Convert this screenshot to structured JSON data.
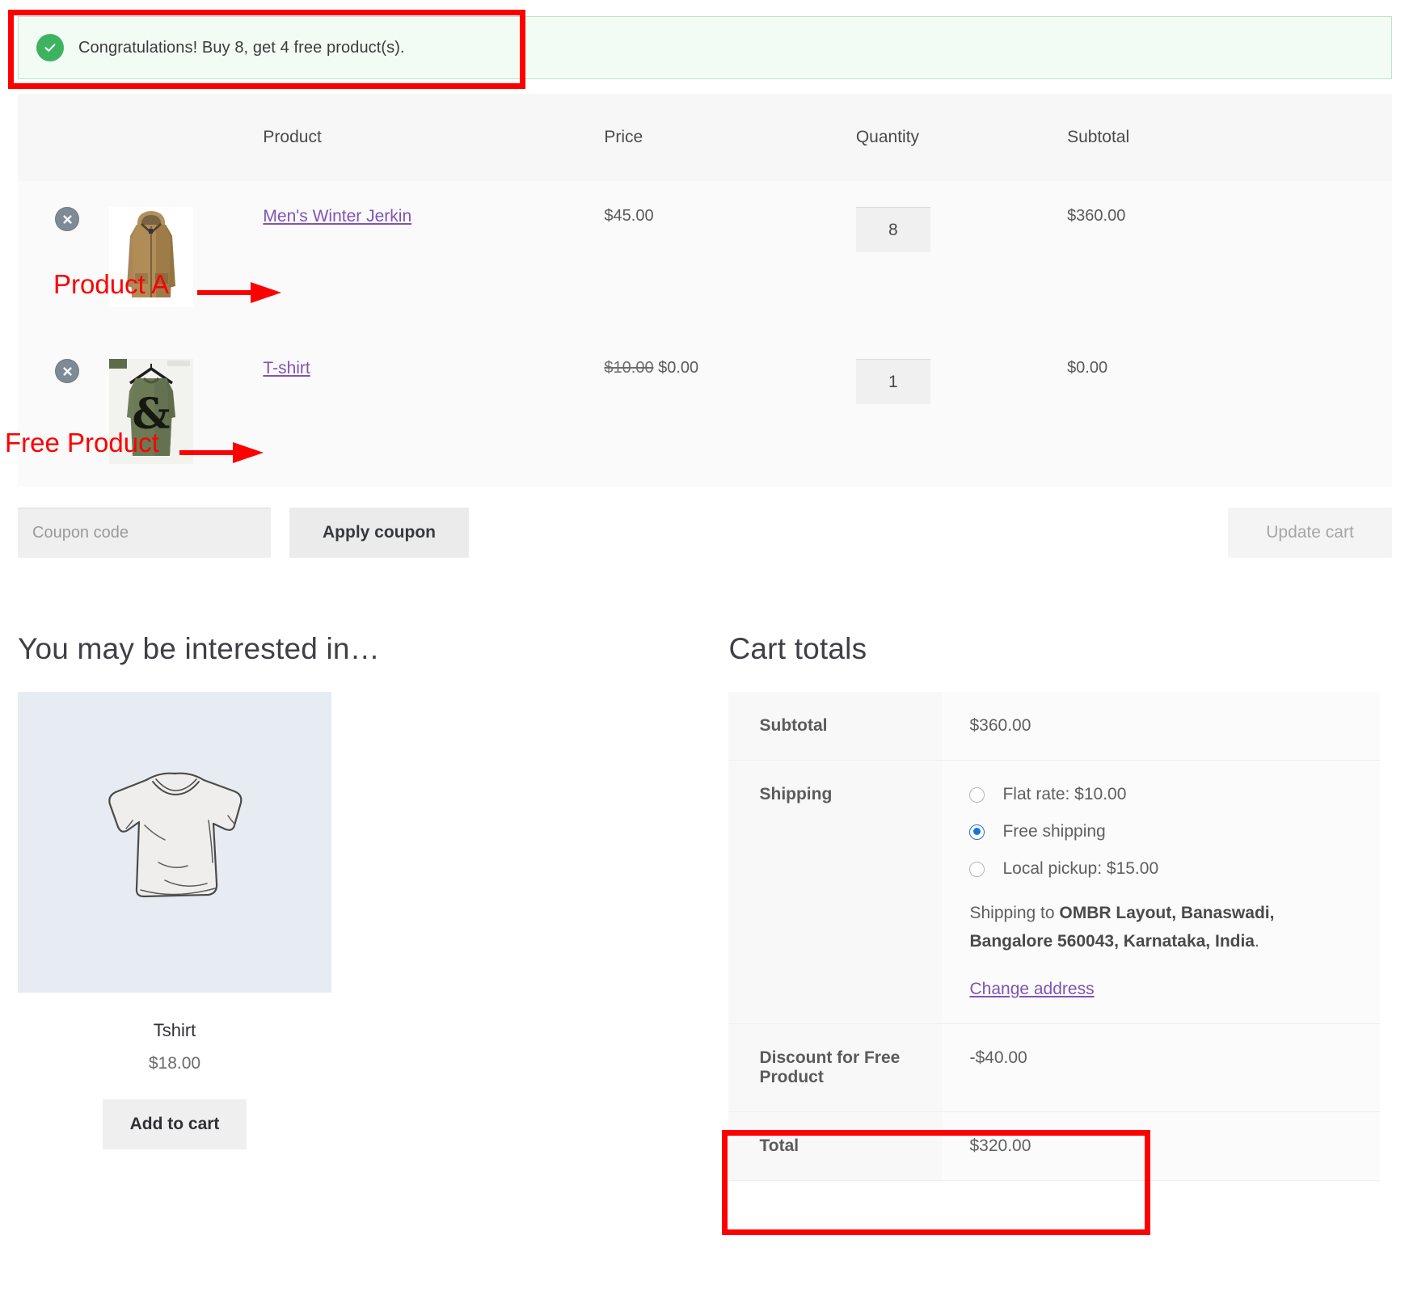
{
  "notice": {
    "icon": "check-circle-icon",
    "message": "Congratulations! Buy 8, get 4 free product(s)."
  },
  "cart_table": {
    "headers": {
      "remove": "",
      "thumbnail": "",
      "product": "Product",
      "price": "Price",
      "quantity": "Quantity",
      "subtotal": "Subtotal"
    },
    "rows": [
      {
        "remove_icon": "remove-item-icon",
        "thumbnail": "mens-winter-jerkin-thumbnail",
        "name": "Men's Winter Jerkin",
        "price": "$45.00",
        "price_original": "",
        "quantity": "8",
        "subtotal": "$360.00"
      },
      {
        "remove_icon": "remove-item-icon",
        "thumbnail": "tshirt-thumbnail",
        "name": "T-shirt",
        "price": "$0.00",
        "price_original": "$10.00",
        "quantity": "1",
        "subtotal": "$0.00"
      }
    ]
  },
  "coupon": {
    "placeholder": "Coupon code",
    "value": "",
    "apply_label": "Apply coupon",
    "update_label": "Update cart"
  },
  "upsells": {
    "heading": "You may be interested in…",
    "products": [
      {
        "image": "white-tshirt-sketch",
        "title": "Tshirt",
        "price": "$18.00",
        "button_label": "Add to cart"
      }
    ]
  },
  "cart_totals": {
    "heading": "Cart totals",
    "subtotal_label": "Subtotal",
    "subtotal_value": "$360.00",
    "shipping_label": "Shipping",
    "shipping_options": [
      {
        "label": "Flat rate: $10.00",
        "selected": false
      },
      {
        "label": "Free shipping",
        "selected": true
      },
      {
        "label": "Local pickup: $15.00",
        "selected": false
      }
    ],
    "shipping_to_prefix": "Shipping to ",
    "shipping_to_address": "OMBR Layout, Banaswadi, Bangalore 560043, Karnataka, India",
    "shipping_to_suffix": ".",
    "change_address_label": "Change address",
    "discount_label": "Discount for Free Product",
    "discount_value": "-$40.00",
    "total_label": "Total",
    "total_value": "$320.00"
  },
  "annotations": [
    {
      "name": "product-a-annotation",
      "text": "Product A"
    },
    {
      "name": "free-product-annotation",
      "text": "Free Product"
    }
  ],
  "colors": {
    "annotation_red": "#fd0000",
    "link_purple": "#7f54b3",
    "notice_green": "#3db360",
    "radio_blue": "#1275e0"
  }
}
